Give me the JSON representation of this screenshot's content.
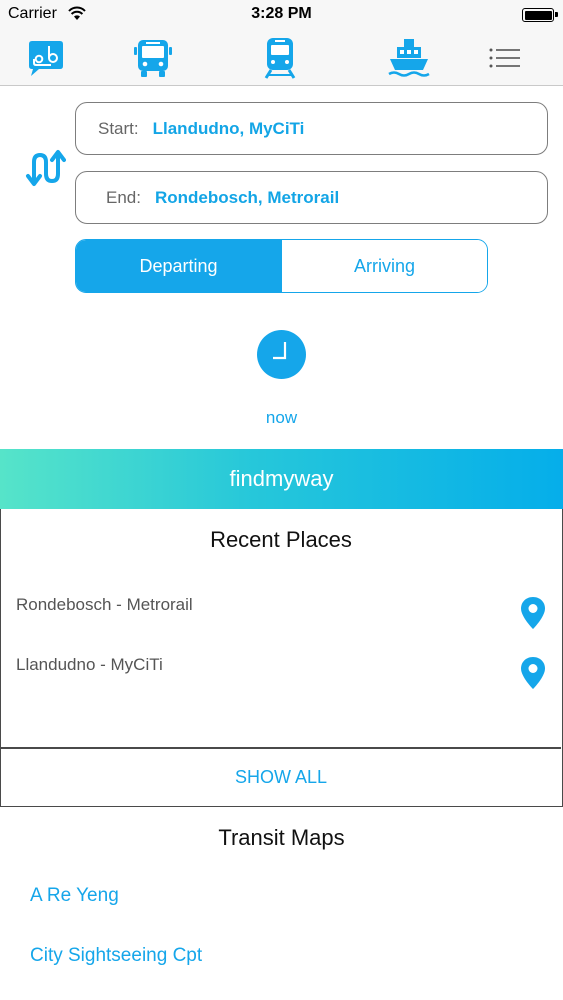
{
  "status_bar": {
    "carrier": "Carrier",
    "time": "3:28 PM"
  },
  "nav": {
    "tabs": [
      {
        "icon": "chat-bubble-logo-icon",
        "active": false
      },
      {
        "icon": "bus-icon",
        "active": false
      },
      {
        "icon": "train-icon",
        "active": false
      },
      {
        "icon": "ferry-icon",
        "active": false
      },
      {
        "icon": "menu-list-icon",
        "active": false
      }
    ]
  },
  "route": {
    "start_label": "Start:",
    "start_value": "Llandudno, MyCiTi",
    "end_label": "End:",
    "end_value": "Rondebosch, Metrorail"
  },
  "timing": {
    "options": [
      "Departing",
      "Arriving"
    ],
    "selected": "Departing",
    "time_value": "now"
  },
  "banner": {
    "text": "findmyway"
  },
  "recent": {
    "title": "Recent Places",
    "places": [
      "Rondebosch - Metrorail",
      "Llandudno - MyCiTi"
    ],
    "show_all_label": "SHOW ALL"
  },
  "transit_maps": {
    "title": "Transit Maps",
    "links": [
      "A Re Yeng",
      "City Sightseeing Cpt"
    ]
  },
  "colors": {
    "accent": "#15a6ea",
    "banner_start": "#56e4c9",
    "banner_end": "#05aeea"
  }
}
